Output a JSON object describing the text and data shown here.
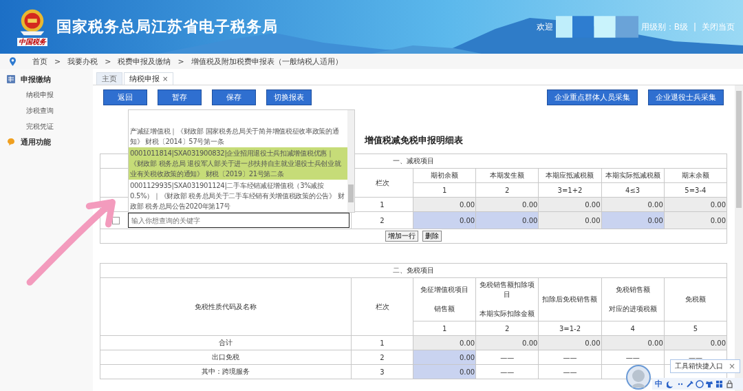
{
  "header": {
    "title": "国家税务总局江苏省电子税务局",
    "logo_text": "中国税务",
    "welcome": "欢迎",
    "credit_level": "用级别：B级",
    "separator": "|",
    "close_page": "关闭当页"
  },
  "breadcrumb": {
    "separator": ">",
    "items": [
      "首页",
      "我要办税",
      "税费申报及缴纳",
      "增值税及附加税费申报表（一般纳税人适用）"
    ]
  },
  "sidebar": [
    {
      "label": "申报缴纳",
      "kind": "grid",
      "children": [
        {
          "label": "纳税申报"
        },
        {
          "label": "涉税查询"
        },
        {
          "label": "完税凭证"
        }
      ]
    },
    {
      "label": "通用功能",
      "kind": "chat"
    }
  ],
  "tabs": [
    {
      "label": "主页",
      "selected": false
    },
    {
      "label": "纳税申报",
      "selected": true,
      "close": "×"
    }
  ],
  "toolbar": {
    "left": [
      "返回",
      "暂存",
      "保存",
      "切换报表"
    ],
    "right": [
      "企业重点群体人员采集",
      "企业退役士兵采集"
    ]
  },
  "form_title": "增值税减免税申报明细表",
  "reduction_table": {
    "section": "一、减税项目",
    "row_header": "栏次",
    "columns": [
      {
        "label": "期初余额",
        "number": "1"
      },
      {
        "label": "本期发生额",
        "number": "2"
      },
      {
        "label": "本期应抵减税额",
        "number": "3=1+2"
      },
      {
        "label": "本期实际抵减税额",
        "number": "4≤3"
      },
      {
        "label": "期末余额",
        "number": "5=3-4"
      }
    ],
    "rows": [
      {
        "line": "1",
        "cells": [
          {
            "text": "0.00",
            "kind": "readonly"
          },
          {
            "text": "0.00",
            "kind": "readonly"
          },
          {
            "text": "0.00",
            "kind": "readonly"
          },
          {
            "text": "0.00",
            "kind": "readonly"
          },
          {
            "text": "0.00",
            "kind": "readonly"
          }
        ]
      },
      {
        "line": "2",
        "checkbox": {
          "checked": false
        },
        "search": {
          "placeholder": "输入你想查询的关键字",
          "options": [
            {
              "text": "产减征增值税｜《财政部 国家税务总局关于简并增值税征收率政策的通知》 财税〔2014〕57号第一条",
              "selected": false
            },
            {
              "text": "0001011814|SXA031900832|企业招用退役士兵扣减增值税优惠｜《财政部 税务总局 退役军人部关于进一步扶持自主就业退役士兵创业就业有关税收政策的通知》 财税〔2019〕21号第二条",
              "selected": true
            },
            {
              "text": "0001129935|SXA031901124|二手车经销减征增值税（3%减按0.5%）｜《财政部 税务总局关于二手车经销有关增值税政策的公告》 财政部 税务总局公告2020年第17号",
              "selected": false
            }
          ]
        },
        "cells": [
          {
            "text": "0.00",
            "kind": "editable"
          },
          {
            "text": "0.00",
            "kind": "editable"
          },
          {
            "text": "0.00",
            "kind": "readonly"
          },
          {
            "text": "0.00",
            "kind": "editable"
          },
          {
            "text": "0.00",
            "kind": "readonly"
          }
        ]
      }
    ],
    "buttons": [
      "增加一行",
      "删除"
    ]
  },
  "exemption_table": {
    "section": "二、免税项目",
    "name_header": "免税性质代码及名称",
    "row_header": "栏次",
    "columns": [
      {
        "lines": [
          "免征增值税项目",
          "销售额"
        ],
        "number": "1"
      },
      {
        "lines": [
          "免税销售额扣除项目",
          "本期实际扣除金额"
        ],
        "number": "2"
      },
      {
        "lines": [
          "扣除后免税销售额"
        ],
        "number": "3=1-2"
      },
      {
        "lines": [
          "免税销售额",
          "对应的进项税额"
        ],
        "number": "4"
      },
      {
        "lines": [
          "免税额"
        ],
        "number": "5"
      }
    ],
    "rows": [
      {
        "name": "合计",
        "line": "1",
        "cells": [
          {
            "text": "0.00",
            "kind": "readonly"
          },
          {
            "text": "0.00",
            "kind": "readonly"
          },
          {
            "text": "0.00",
            "kind": "readonly"
          },
          {
            "text": "0.00",
            "kind": "readonly"
          },
          {
            "text": "0.00",
            "kind": "readonly"
          }
        ]
      },
      {
        "name": "出口免税",
        "line": "2",
        "cells": [
          {
            "text": "0.00",
            "kind": "editable"
          },
          {
            "text": "——",
            "kind": "na"
          },
          {
            "text": "——",
            "kind": "na"
          },
          {
            "text": "——",
            "kind": "na"
          },
          {
            "text": "——",
            "kind": "na"
          }
        ]
      },
      {
        "name": "其中：跨境服务",
        "line": "3",
        "cells": [
          {
            "text": "0.00",
            "kind": "editable"
          },
          {
            "text": "——",
            "kind": "na"
          },
          {
            "text": "——",
            "kind": "na"
          }
        ]
      }
    ]
  },
  "annotation": {
    "kind": "arrow"
  },
  "toolbox": {
    "label": "工具箱快捷入口",
    "close": "×"
  },
  "ime_bar": {
    "mode": "中"
  }
}
